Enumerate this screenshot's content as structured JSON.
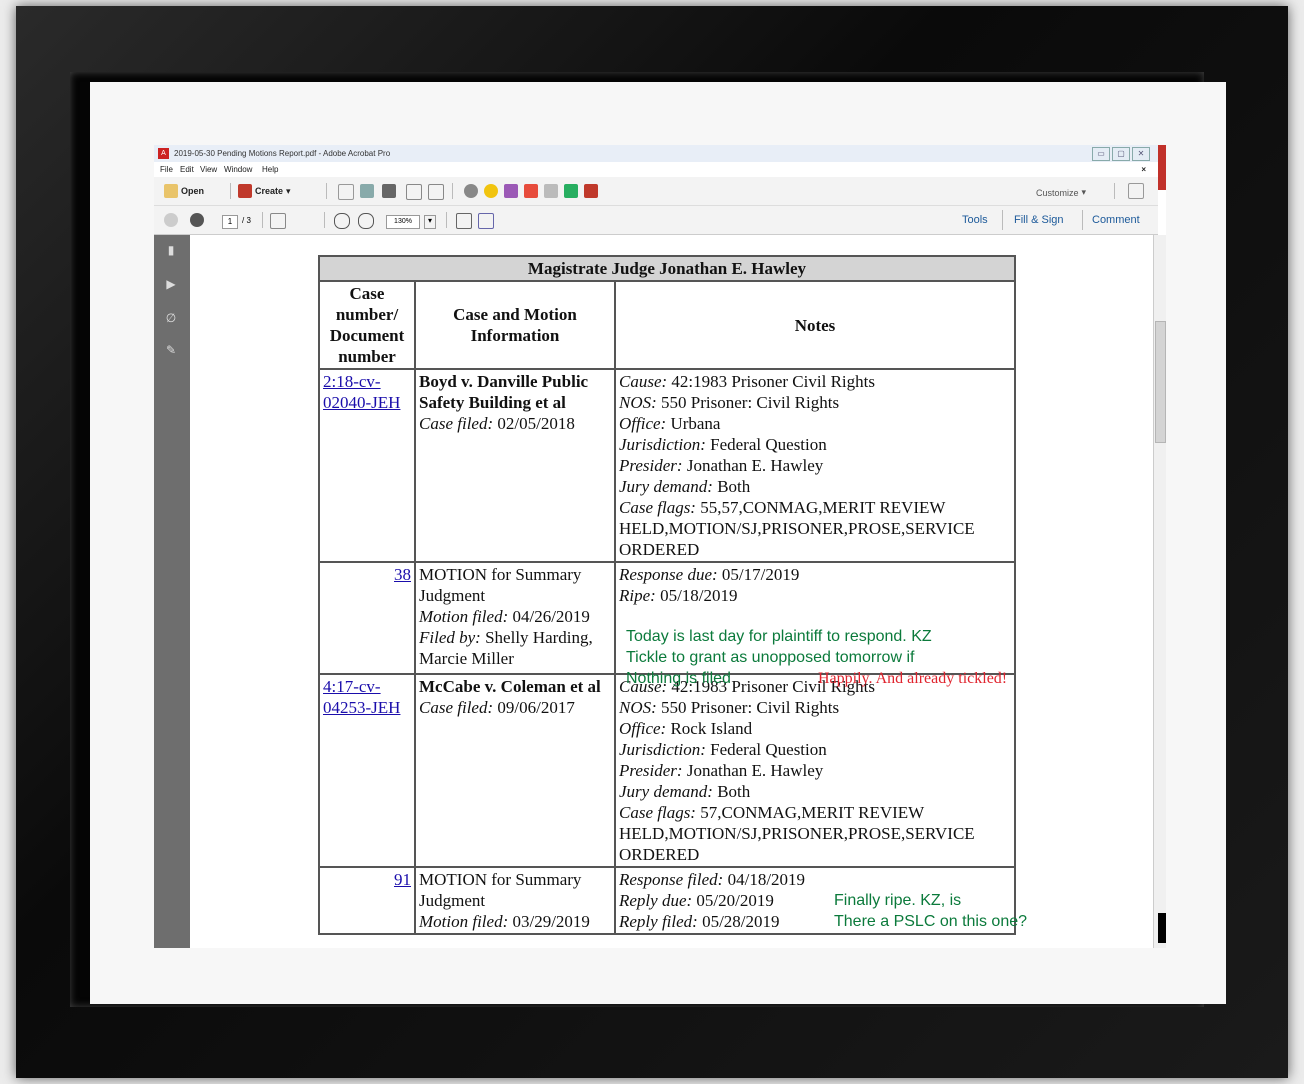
{
  "window": {
    "title": "2019-05-30 Pending Motions Report.pdf - Adobe Acrobat Pro",
    "buttons": [
      "▭",
      "▢",
      "✕"
    ]
  },
  "menu": {
    "items": [
      "File",
      "Edit",
      "View",
      "Window",
      "Help"
    ],
    "close": "×"
  },
  "toolbar": {
    "open_label": "Open",
    "create_label": "Create",
    "customize_label": "Customize"
  },
  "nav": {
    "page_current": "1",
    "page_total": "/ 3",
    "zoom": "130%",
    "tabs": [
      "Tools",
      "Fill & Sign",
      "Comment"
    ]
  },
  "report": {
    "judge_header": "Magistrate Judge Jonathan E. Hawley",
    "col_case_number": "Case number/ Document number",
    "col_case_info": "Case and Motion Information",
    "col_notes": "Notes",
    "rows": [
      {
        "case_link": "2:18-cv-02040-JEH",
        "case_name": "Boyd v. Danville Public Safety Building et al",
        "case_filed_label": "Case filed:",
        "case_filed": "02/05/2018",
        "notes": [
          {
            "label": "Cause:",
            "value": "42:1983 Prisoner Civil Rights"
          },
          {
            "label": "NOS:",
            "value": "550 Prisoner: Civil Rights"
          },
          {
            "label": "Office:",
            "value": "Urbana"
          },
          {
            "label": "Jurisdiction:",
            "value": "Federal Question"
          },
          {
            "label": "Presider:",
            "value": "Jonathan E. Hawley"
          },
          {
            "label": "Jury demand:",
            "value": "Both"
          },
          {
            "label": "Case flags:",
            "value": "55,57,CONMAG,MERIT REVIEW HELD,MOTION/SJ,PRISONER,PROSE,SERVICE ORDERED"
          }
        ]
      },
      {
        "doc_link": "38",
        "motion": "MOTION for Summary Judgment",
        "motion_filed_label": "Motion filed:",
        "motion_filed": "04/26/2019",
        "filed_by_label": "Filed by:",
        "filed_by": "Shelly Harding, Marcie Miller",
        "notes": [
          {
            "label": "Response due:",
            "value": "05/17/2019"
          },
          {
            "label": "Ripe:",
            "value": "05/18/2019"
          }
        ]
      },
      {
        "case_link": "4:17-cv-04253-JEH",
        "case_name": "McCabe v. Coleman et al",
        "case_filed_label": "Case filed:",
        "case_filed": "09/06/2017",
        "notes": [
          {
            "label": "Cause:",
            "value": "42:1983 Prisoner Civil Rights"
          },
          {
            "label": "NOS:",
            "value": "550 Prisoner: Civil Rights"
          },
          {
            "label": "Office:",
            "value": "Rock Island"
          },
          {
            "label": "Jurisdiction:",
            "value": "Federal Question"
          },
          {
            "label": "Presider:",
            "value": "Jonathan E. Hawley"
          },
          {
            "label": "Jury demand:",
            "value": "Both"
          },
          {
            "label": "Case flags:",
            "value": "57,CONMAG,MERIT REVIEW HELD,MOTION/SJ,PRISONER,PROSE,SERVICE ORDERED"
          }
        ]
      },
      {
        "doc_link": "91",
        "motion": "MOTION for Summary Judgment",
        "motion_filed_label": "Motion filed:",
        "motion_filed": "03/29/2019",
        "notes": [
          {
            "label": "Response filed:",
            "value": "04/18/2019"
          },
          {
            "label": "Reply due:",
            "value": "05/20/2019"
          },
          {
            "label": "Reply filed:",
            "value": "05/28/2019"
          }
        ]
      }
    ]
  },
  "annotations": {
    "green_1_line1": "Today is last day for plaintiff to respond. KZ",
    "green_1_line2": "Tickle to grant as unopposed tomorrow if",
    "green_1_line3": "Nothing is filed",
    "red_1": "Happily. And already tickled!",
    "green_2_line1": "Finally ripe. KZ, is",
    "green_2_line2": "There a PSLC on this one?"
  },
  "colors": {
    "annotation_green": "#0b7a3b",
    "annotation_red": "#e0242e",
    "link": "#1a0dab",
    "header_gray": "#d4d4d4"
  }
}
